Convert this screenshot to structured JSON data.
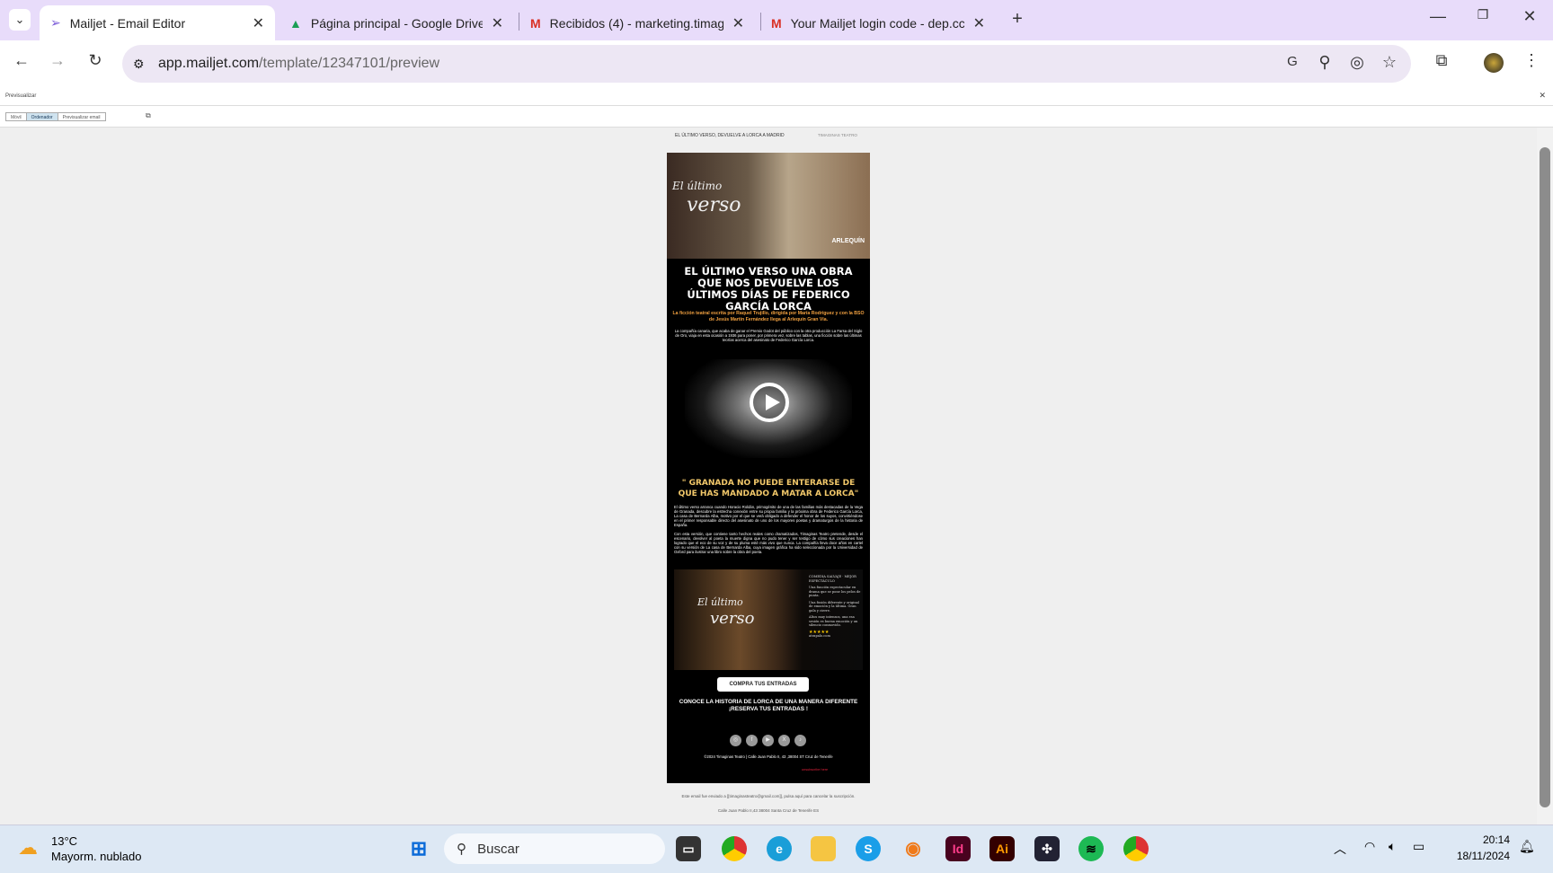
{
  "browser": {
    "tabs": [
      {
        "title": "Mailjet - Email Editor",
        "active": true
      },
      {
        "title": "Página principal - Google Drive"
      },
      {
        "title": "Recibidos (4) - marketing.timag"
      },
      {
        "title": "Your Mailjet login code - dep.cc"
      }
    ],
    "url_host": "app.mailjet.com",
    "url_path": "/template/12347101/preview"
  },
  "preview": {
    "title": "Previsualizar",
    "modes": [
      "Móvil",
      "Ordenador",
      "Previsualizar email"
    ],
    "active_mode": "Ordenador"
  },
  "email": {
    "preheader": "EL ÚLTIMO VERSO, DEVUELVE A LORCA A MADRID",
    "sender": "TIMAGINAS TEATRO",
    "hero_script_1": "El último",
    "hero_script_2": "verso",
    "hero_logo": "ARLEQUÍN",
    "headline": "EL ÚLTIMO VERSO UNA OBRA QUE NOS DEVUELVE LOS ÚLTIMOS DÍAS DE FEDERICO GARCÍA LORCA",
    "subheadline": "La ficción teatral escrita por Raquel Trujillo, dirigida por María Rodríguez y con la BSO de Jesús Martín Fernández llega al Arlequín Gran Vía.",
    "intro": "La compañía canaria, que acaba de ganar el Premio Godot del público con la otra producción La Farsa del Siglo de Oro, viaja en esta ocasión a 1936 para poner, por primera vez, sobre las tablas, una ficción sobre las últimas teorías acerca del asesinato de Federico García Lorca.",
    "quote": "\" GRANADA NO PUEDE ENTERARSE DE QUE HAS MANDADO A MATAR A LORCA\"",
    "paragraph1": "El último verso arranca cuando Horacio Roldán, primogénito de una de las familias más destacadas de la Vega de Granada, descubre la estrecha conexión entre su propia familia y la próxima obra de Federico García Lorca, La casa de Bernarda Alba, motivo por el que se verá obligado a defender el honor de los suyos, convirtiéndose en el primer responsable directo del asesinato de uno de los mayores poetas y dramaturgos de la historia de España.",
    "paragraph2": "Con esta versión, que contiene tanto hechos reales como dramatizados, Timaginas Teatro pretende, desde el escenario, devolver al poeta la muerte digna que no pudo tener y ser testigo de cómo sus creaciones han logrado que el eco de su voz y de su pluma esté más vivo que nunca. La compañía lleva doce años en cartel con su versión de La casa de Bernarda Alba, cuya imagen gráfica ha sido seleccionada por la Universidad de Oxford para ilustrar una libro sobre la obra del poeta.",
    "poster_reviews": [
      "COMEDIA SALVAJE · MEJOR ESPECTÁCULO",
      "Una función espectacular en drama que se pone los pelos de punta.",
      "Una fusión diferente y original de emoción y la última. Gran gala y cierre.",
      "Altos muy intensos, una esa sesión es buena emoción y un silencio conmovido."
    ],
    "poster_rating": "★★★★★",
    "poster_site": "atrapalo.com",
    "cta_button": "COMPRA TUS ENTRADAS",
    "cta_text": "CONOCE LA HISTORIA DE LORCA DE UNA MANERA DIFERENTE ¡RESERVA TUS ENTRADAS !",
    "social": [
      "instagram",
      "facebook",
      "youtube",
      "x",
      "tiktok"
    ],
    "address": "©2024 Timaginas Teatro | Calle Juan Pablo II, 43 ,38004 ST Cruz de Tenerife",
    "unsubscribe": "unsubscribe here"
  },
  "footer": {
    "sent_to": "Este email fue enviado a [[timaginasteatro@gmail.com]], pulsa aquí para cancelar la suscripción.",
    "address": "Calle Juan Pablo II,43 38004 Santa Cruz de Tenerife ES"
  },
  "taskbar": {
    "temp": "13°C",
    "weather": "Mayorm. nublado",
    "search": "Buscar",
    "time": "20:14",
    "date": "18/11/2024"
  }
}
